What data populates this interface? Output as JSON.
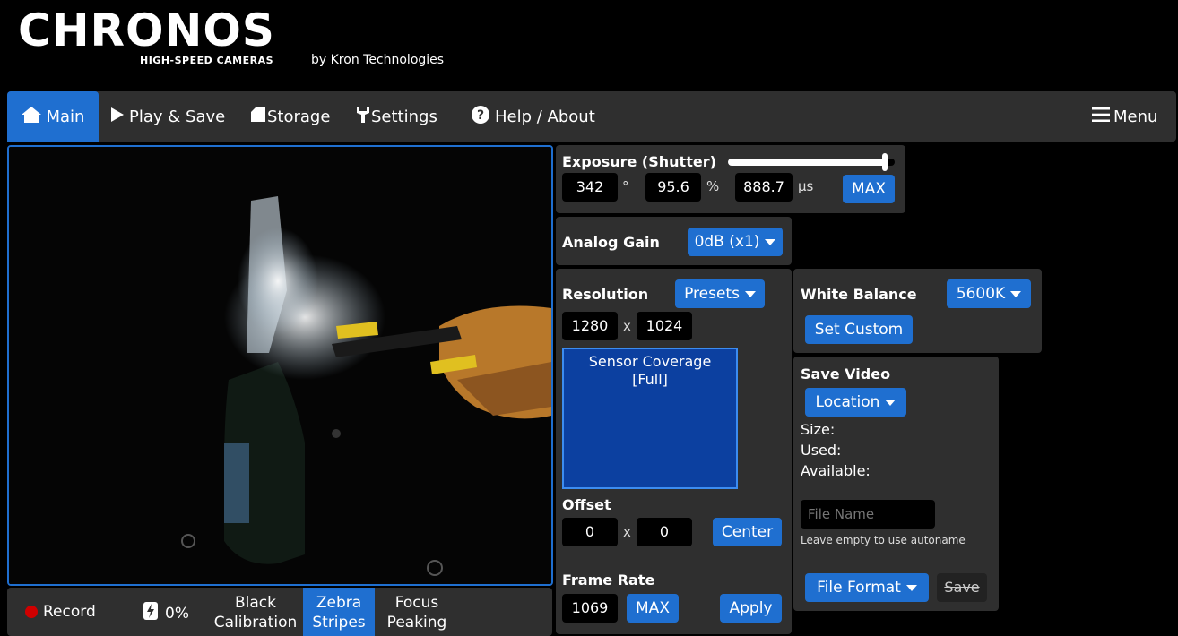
{
  "brand": {
    "logo": "CHRONOS",
    "tagline": "HIGH-SPEED CAMERAS",
    "by": "by Kron Technologies"
  },
  "nav": {
    "main": "Main",
    "play_save": "Play & Save",
    "storage": "Storage",
    "settings": "Settings",
    "help": "Help / About",
    "menu": "Menu"
  },
  "bottom_bar": {
    "record": "Record",
    "battery": "0%",
    "black_calibration": [
      "Black",
      "Calibration"
    ],
    "zebra_stripes": [
      "Zebra",
      "Stripes"
    ],
    "focus_peaking": [
      "Focus",
      "Peaking"
    ]
  },
  "exposure": {
    "label": "Exposure (Shutter)",
    "degrees": "342",
    "deg_unit": "°",
    "percent": "95.6",
    "pct_unit": "%",
    "micros": "888.7",
    "us_unit": "µs",
    "max": "MAX",
    "slider_level": 0.95
  },
  "gain": {
    "label": "Analog Gain",
    "value": "0dB (x1)"
  },
  "resolution": {
    "label": "Resolution",
    "presets": "Presets",
    "width": "1280",
    "x": "x",
    "height": "1024",
    "coverage_line1": "Sensor Coverage",
    "coverage_line2": "[Full]"
  },
  "offset": {
    "label": "Offset",
    "x": "0",
    "sep": "x",
    "y": "0",
    "center": "Center"
  },
  "framerate": {
    "label": "Frame Rate",
    "value": "1069",
    "max": "MAX",
    "apply": "Apply"
  },
  "white_balance": {
    "label": "White Balance",
    "value": "5600K",
    "set_custom": "Set Custom"
  },
  "save_video": {
    "label": "Save Video",
    "location": "Location",
    "size": "Size:",
    "used": "Used:",
    "available": "Available:",
    "filename_placeholder": "File Name",
    "hint": "Leave empty to use autoname",
    "file_format": "File Format",
    "save": "Save"
  },
  "colors": {
    "accent": "#1f6fd0",
    "panel": "#2f2f2f",
    "record": "#d00000"
  }
}
